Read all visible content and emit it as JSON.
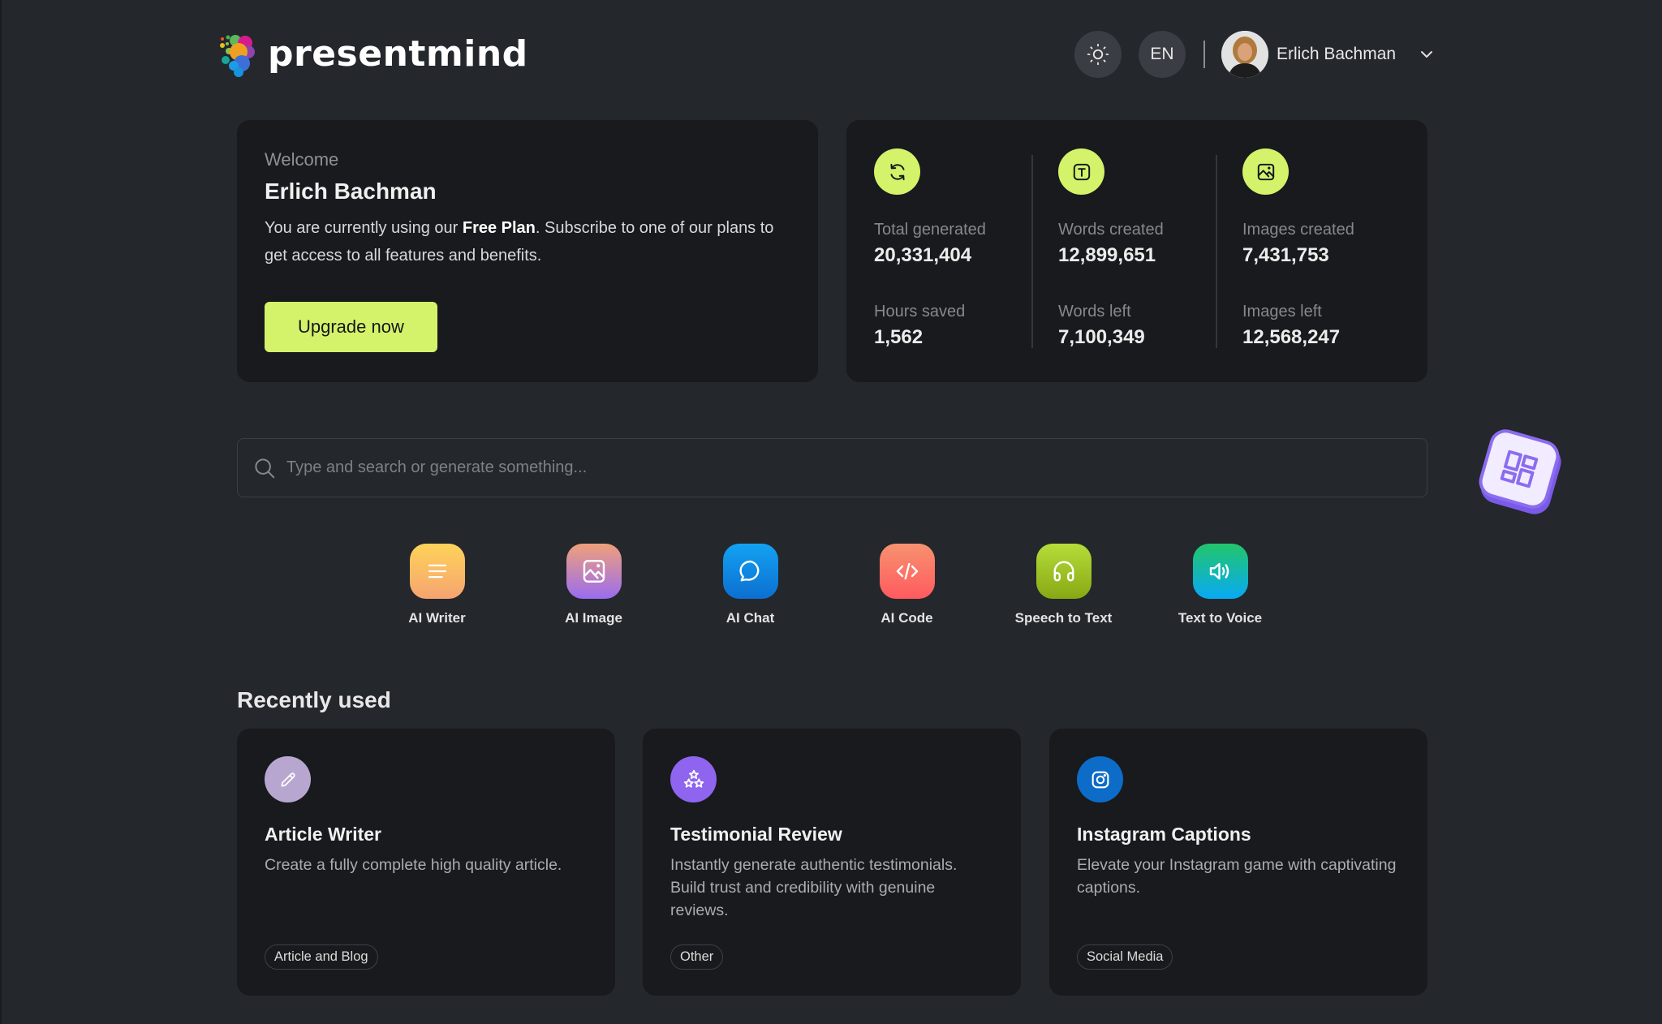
{
  "header": {
    "brand": "presentmind",
    "theme_toggle": "sun-icon",
    "language": "EN",
    "user_name": "Erlich Bachman"
  },
  "welcome": {
    "greeting": "Welcome",
    "name": "Erlich Bachman",
    "message_prefix": "You are currently using our ",
    "plan": "Free Plan",
    "message_suffix": ". Subscribe to one of our plans to get access to all features and benefits.",
    "cta": "Upgrade now",
    "accent_color": "#d4f26a"
  },
  "stats": [
    {
      "icon": "refresh-icon",
      "label1": "Total generated",
      "value1": "20,331,404",
      "label2": "Hours saved",
      "value2": "1,562"
    },
    {
      "icon": "text-icon",
      "label1": "Words created",
      "value1": "12,899,651",
      "label2": "Words left",
      "value2": "7,100,349"
    },
    {
      "icon": "image-icon",
      "label1": "Images created",
      "value1": "7,431,753",
      "label2": "Images left",
      "value2": "12,568,247"
    }
  ],
  "search": {
    "placeholder": "Type and search or generate something...",
    "value": ""
  },
  "tools": [
    {
      "label": "AI Writer",
      "icon": "lines-icon",
      "gradient": [
        "#ffd35a",
        "#f5a470"
      ]
    },
    {
      "label": "AI Image",
      "icon": "image-icon",
      "gradient": [
        "#f0a07a",
        "#9a6cf0"
      ]
    },
    {
      "label": "AI Chat",
      "icon": "chat-bubble-icon",
      "gradient": [
        "#13a2f2",
        "#0c6fd1"
      ]
    },
    {
      "label": "AI Code",
      "icon": "code-icon",
      "gradient": [
        "#f7926f",
        "#ff5a5f"
      ]
    },
    {
      "label": "Speech to Text",
      "icon": "headphones-icon",
      "gradient": [
        "#b6dd3a",
        "#87a814"
      ]
    },
    {
      "label": "Text to Voice",
      "icon": "speaker-icon",
      "gradient": [
        "#22c56a",
        "#08aaf5"
      ]
    }
  ],
  "recent": {
    "title": "Recently used",
    "items": [
      {
        "title": "Article Writer",
        "desc": "Create a fully complete high quality article.",
        "tag": "Article and Blog",
        "icon": "pencil-icon",
        "color": "#b7a7d0"
      },
      {
        "title": "Testimonial Review",
        "desc": "Instantly generate authentic testimonials. Build trust and credibility with genuine reviews.",
        "tag": "Other",
        "icon": "stars-icon",
        "color": "#8f64ef"
      },
      {
        "title": "Instagram Captions",
        "desc": "Elevate your Instagram game with captivating captions.",
        "tag": "Social Media",
        "icon": "instagram-icon",
        "color": "#0d6cc7"
      }
    ]
  }
}
